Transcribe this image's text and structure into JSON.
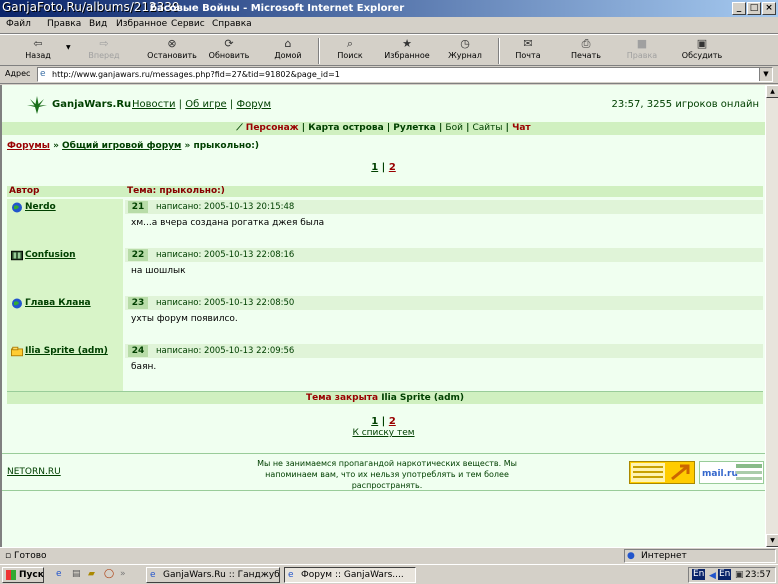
{
  "window": {
    "watermark": "GanjaFoto.Ru/albums/212339",
    "title": "басовые Войны - Microsoft Internet Explorer"
  },
  "menu": [
    "Файл",
    "Правка",
    "Вид",
    "Избранное",
    "Сервис",
    "Справка"
  ],
  "toolbar": {
    "back": "Назад",
    "forward": "Вперед",
    "stop": "Остановить",
    "refresh": "Обновить",
    "home": "Домой",
    "search": "Поиск",
    "favorites": "Избранное",
    "history": "Журнал",
    "mail": "Почта",
    "print": "Печать",
    "edit": "Правка",
    "discuss": "Обсудить"
  },
  "address": {
    "label": "Адрес",
    "url": "http://www.ganjawars.ru/messages.php?fid=27&tid=91802&page_id=1"
  },
  "site": {
    "name": "GanjaWars.Ru",
    "sep": "|",
    "nav": [
      "Новости",
      "Об игре",
      "Форум"
    ],
    "online": "23:57, 3255 игроков онлайн",
    "menu": [
      "Персонаж",
      "Карта острова",
      "Рулетка",
      "Бой",
      "Сайты",
      "Чат"
    ]
  },
  "breadcrumb": {
    "forums": "Форумы",
    "arrow": "»",
    "general": "Общий игровой форум",
    "topic": "прыкольно:)"
  },
  "pager": {
    "p1": "1",
    "sep": "|",
    "p2": "2"
  },
  "thead": {
    "author": "Автор",
    "topic": "Тема: прыкольно:)"
  },
  "posts": [
    {
      "author": "Nerdo",
      "num": "21",
      "date": "написано: 2005-10-13 20:15:48",
      "text": "хм...а вчера создана рогатка джея была"
    },
    {
      "author": "Confusion",
      "num": "22",
      "date": "написано: 2005-10-13 22:08:16",
      "text": "на шошлык"
    },
    {
      "author": "Глава Клана",
      "num": "23",
      "date": "написано: 2005-10-13 22:08:50",
      "text": "ухты форум появилсо."
    },
    {
      "author": "Ilia Sprite (adm)",
      "num": "24",
      "date": "написано: 2005-10-13 22:09:56",
      "text": "баян."
    }
  ],
  "closed": {
    "label": "Тема закрыта",
    "by": "Ilia Sprite (adm)"
  },
  "to_list": "К списку тем",
  "footer": {
    "netorn": "NETORN.RU",
    "disclaimer": "Мы не занимаемся пропагандой наркотических веществ. Мы напоминаем вам, что их нельзя употреблять и тем более распространять.",
    "counter": "SPYLOG",
    "mail": "mail.ru"
  },
  "status": {
    "text": "Готово",
    "zone": "Интернет"
  },
  "taskbar": {
    "start": "Пуск",
    "task1": "GanjaWars.Ru :: Ганджуб...",
    "task2": "Форум :: GanjaWars....",
    "lang1": "En",
    "lang2": "En",
    "clock": "23:57"
  }
}
